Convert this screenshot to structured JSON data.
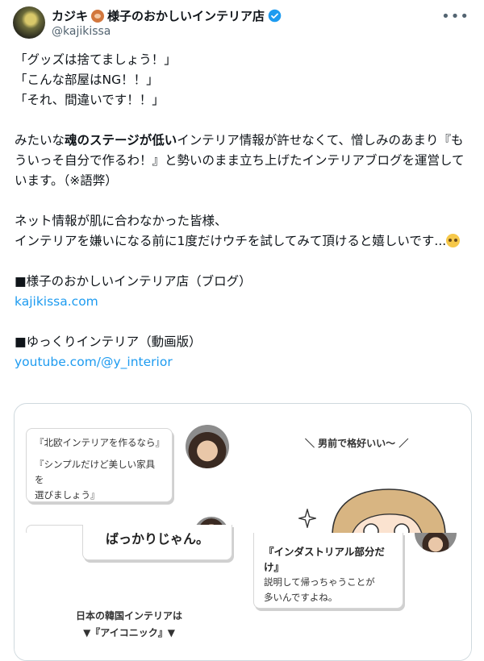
{
  "author": {
    "name": "カジキ🐵様子のおかしいインテリア店",
    "name_prefix": "カジキ",
    "name_suffix": "様子のおかしいインテリア店",
    "handle": "@kajikissa",
    "verified": true
  },
  "more_label": "•••",
  "bio": {
    "quote1": "「グッズは捨てましょう！」",
    "quote2": "「こんな部屋はNG！！」",
    "quote3": "「それ、間違いです！！」",
    "para1_a": "みたいな",
    "para1_bold": "魂のステージが低い",
    "para1_b": "インテリア情報が許せなくて、憎しみのあまり『もういっそ自分で作るわ！』と勢いのまま立ち上げたインテリアブログを運営しています。（※語弊）",
    "para2_line1": "ネット情報が肌に合わなかった皆様、",
    "para2_line2": "インテリアを嫌いになる前に1度だけウチを試してみて頂けると嬉しいです...",
    "blog_heading": "■様子のおかしいインテリア店（ブログ）",
    "blog_link": "kajikissa.com",
    "video_heading": "■ゆっくりインテリア（動画版）",
    "video_link": "youtube.com/@y_interior"
  },
  "media": {
    "bubble1_line1": "『北欧インテリアを作るなら』",
    "bubble1_line2": "『シンプルだけど美しい家具を",
    "bubble1_line3": "選びましょう』",
    "caption_top": "＼ 男前で格好いい〜 ／",
    "bubble2_text": "ばっかりじゃん。",
    "bubble3_bold": "『インダストリアル部分だけ』",
    "bubble3_line1": "説明して帰っちゃうことが",
    "bubble3_line2": "多いんですよね。",
    "korean_line1": "日本の韓国インテリアは",
    "korean_line2": "▼『アイコニック』▼"
  },
  "colors": {
    "link": "#1d9bf0",
    "verified": "#1d9bf0",
    "muted": "#536471"
  }
}
